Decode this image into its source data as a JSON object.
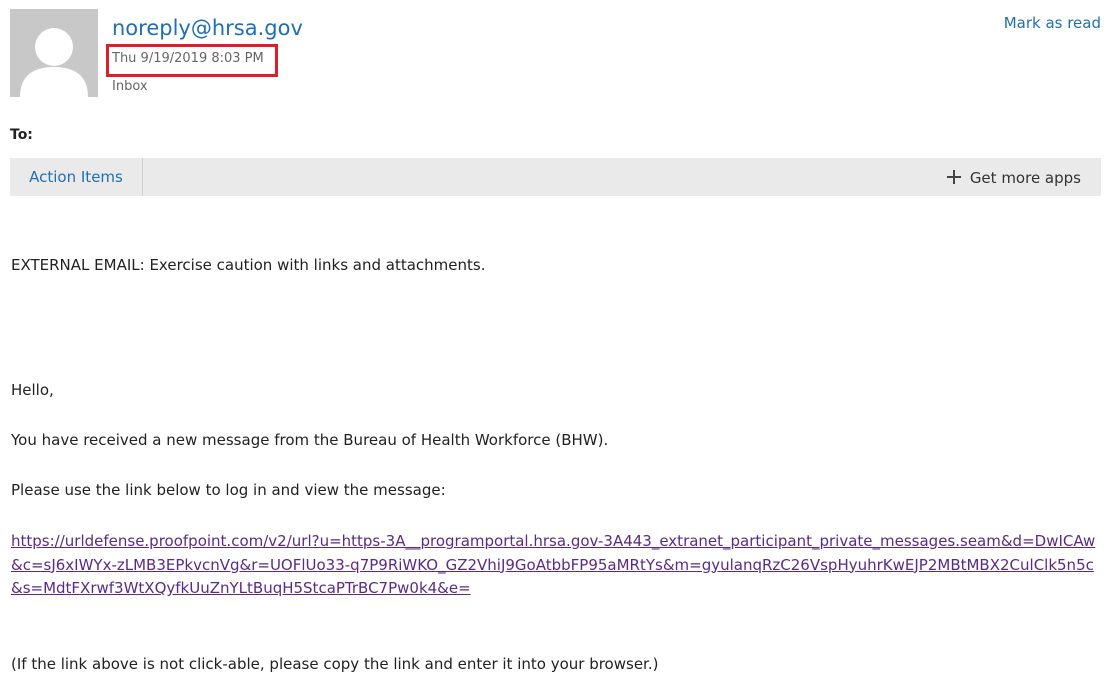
{
  "header": {
    "sender": "noreply@hrsa.gov",
    "date": "Thu 9/19/2019 8:03 PM",
    "folder": "Inbox",
    "mark_as_read": "Mark as read"
  },
  "to_label": "To:",
  "apps_bar": {
    "action_items": "Action Items",
    "get_more_apps": "Get more apps"
  },
  "email_body": {
    "external_warning": "EXTERNAL EMAIL: Exercise caution with links and attachments.",
    "greeting": "Hello,",
    "line1": "You have received a new message from the Bureau of Health Workforce (BHW).",
    "line2": "Please use the link below to log in and view the message:",
    "link": "https://urldefense.proofpoint.com/v2/url?u=https-3A__programportal.hrsa.gov-3A443_extranet_participant_private_messages.seam&d=DwICAw&c=sJ6xIWYx-zLMB3EPkvcnVg&r=UOFlUo33-q7P9RiWKO_GZ2VhiJ9GoAtbbFP95aMRtYs&m=gyulanqRzC26VspHyuhrKwEJP2MBtMBX2CulClk5n5c&s=MdtFXrwf3WtXQyfkUuZnYLtBuqH5StcaPTrBC7Pw0k4&e=",
    "note": "(If the link above is not click-able, please copy the link and enter it into your browser.)"
  },
  "colors": {
    "accent": "#1f6fb5",
    "highlight_box": "#e01e2b",
    "visited_link": "#5b2a86",
    "toolbar_bg": "#eaeaea"
  },
  "icons": [
    "person-avatar-icon",
    "plus-icon"
  ]
}
